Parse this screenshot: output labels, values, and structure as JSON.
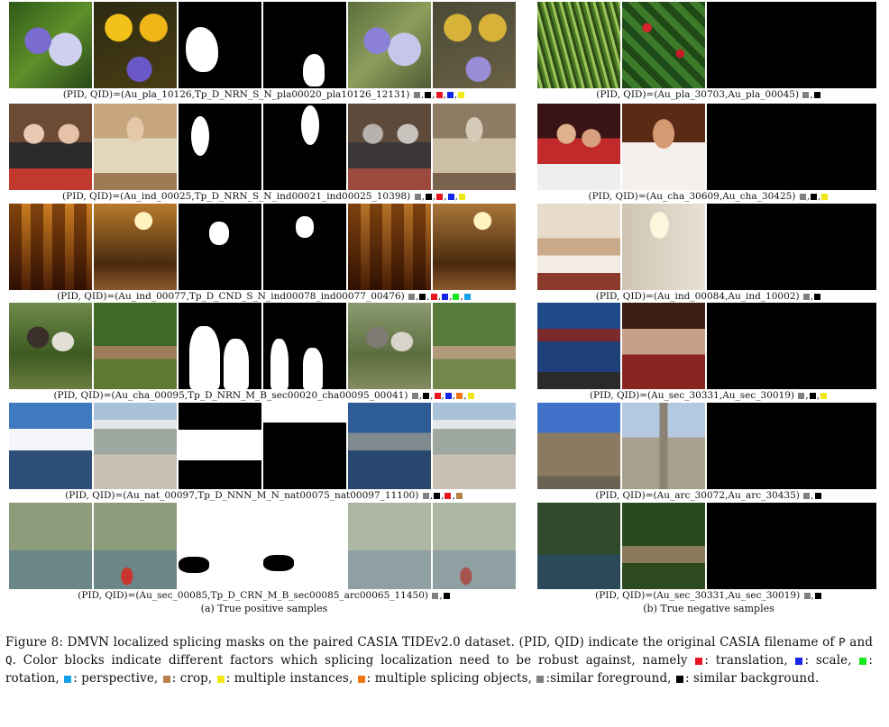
{
  "figure": {
    "left_subcaption": "(a) True positive samples",
    "right_subcaption": "(b) True negative samples",
    "caption": {
      "label": "Figure 8:",
      "text_1": "DMVN localized splicing masks on the paired CASIA TIDEv2.0 dataset. (PID, QID) indicate the original CASIA filename of",
      "p": "P",
      "and": "and",
      "q": "Q",
      "text_2": ". Color blocks indicate different factors which splicing localization need to be robust against, namely",
      "legend": [
        {
          "color": "#e8141e",
          "text": ": translation,"
        },
        {
          "color": "#1424e8",
          "text": ": scale,"
        },
        {
          "color": "#14e81e",
          "text": ": rotation,"
        },
        {
          "color": "#14a0e8",
          "text": ": perspective,"
        },
        {
          "color": "#b8804a",
          "text": ": crop,"
        },
        {
          "color": "#f0e814",
          "text": ": multiple instances,"
        },
        {
          "color": "#f07814",
          "text": ": multiple splicing objects,"
        },
        {
          "color": "#808080",
          "text": ":similar foreground,"
        },
        {
          "color": "#000000",
          "text": ": similar background."
        }
      ]
    }
  },
  "positive_samples": [
    {
      "caption": "(PID, QID)=(Au_pla_10126,Tp_D_NRN_S_N_pla00020_pla10126_12131)",
      "factors": [
        "#808080",
        "#000000",
        "#e8141e",
        "#1424e8",
        "#f0e814"
      ]
    },
    {
      "caption": "(PID, QID)=(Au_ind_00025,Tp_D_NRN_S_N_ind00021_ind00025_10398)",
      "factors": [
        "#808080",
        "#000000",
        "#e8141e",
        "#1424e8",
        "#f0e814"
      ]
    },
    {
      "caption": "(PID, QID)=(Au_ind_00077,Tp_D_CND_S_N_ind00078_ind00077_00476)",
      "factors": [
        "#808080",
        "#000000",
        "#e8141e",
        "#1424e8",
        "#14e81e",
        "#14a0e8"
      ]
    },
    {
      "caption": "(PID, QID)=(Au_cha_00095,Tp_D_NRN_M_B_sec00020_cha00095_00041)",
      "factors": [
        "#808080",
        "#000000",
        "#e8141e",
        "#1424e8",
        "#f07814",
        "#f0e814"
      ]
    },
    {
      "caption": "(PID, QID)=(Au_nat_00097,Tp_D_NNN_M_N_nat00075_nat00097_11100)",
      "factors": [
        "#808080",
        "#000000",
        "#e8141e",
        "#b8804a"
      ]
    },
    {
      "caption": "(PID, QID)=(Au_sec_00085,Tp_D_CRN_M_B_sec00085_arc00065_11450)",
      "factors": [
        "#808080",
        "#000000"
      ]
    }
  ],
  "negative_samples": [
    {
      "caption": "(PID, QID)=(Au_pla_30703,Au_pla_00045)",
      "factors": [
        "#808080",
        "#000000"
      ]
    },
    {
      "caption": "(PID, QID)=(Au_cha_30609,Au_cha_30425)",
      "factors": [
        "#808080",
        "#000000",
        "#f0e814"
      ]
    },
    {
      "caption": "(PID, QID)=(Au_ind_00084,Au_ind_10002)",
      "factors": [
        "#808080",
        "#000000"
      ]
    },
    {
      "caption": "(PID, QID)=(Au_sec_30331,Au_sec_30019)",
      "factors": [
        "#808080",
        "#000000",
        "#f0e814"
      ]
    },
    {
      "caption": "(PID, QID)=(Au_arc_30072,Au_arc_30435)",
      "factors": [
        "#808080",
        "#000000"
      ]
    },
    {
      "caption": "(PID, QID)=(Au_sec_30331,Au_sec_30019)",
      "factors": [
        "#808080",
        "#000000"
      ]
    }
  ]
}
